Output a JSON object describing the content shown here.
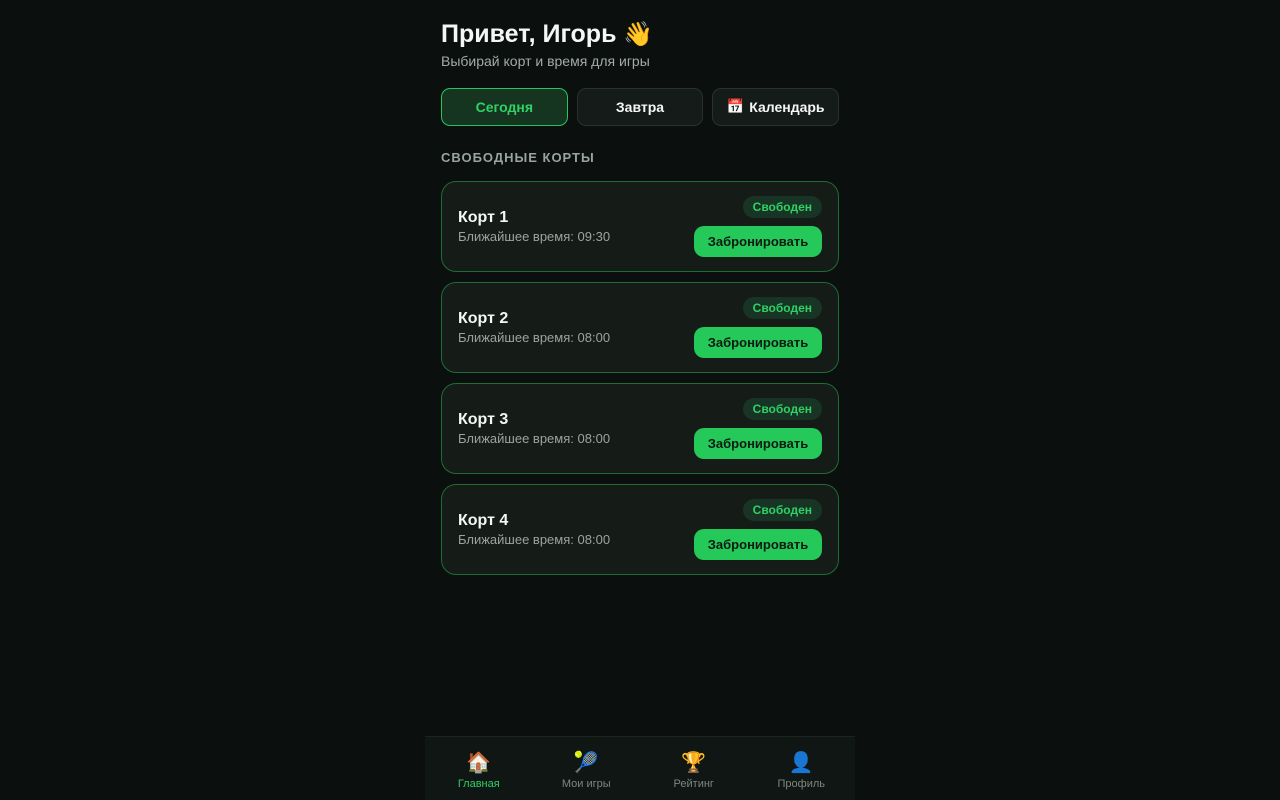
{
  "header": {
    "greeting": "Привет, Игорь",
    "wave_emoji": "👋",
    "subtitle": "Выбирай корт и время для игры"
  },
  "day_tabs": [
    {
      "label": "Сегодня",
      "active": true
    },
    {
      "label": "Завтра",
      "active": false
    },
    {
      "label": "Календарь",
      "icon": "📅",
      "active": false
    }
  ],
  "section_title": "СВОБОДНЫЕ КОРТЫ",
  "courts": [
    {
      "name": "Корт 1",
      "time_prefix": "Ближайшее время:",
      "time": "09:30",
      "status": "Свободен",
      "book_label": "Забронировать"
    },
    {
      "name": "Корт 2",
      "time_prefix": "Ближайшее время:",
      "time": "08:00",
      "status": "Свободен",
      "book_label": "Забронировать"
    },
    {
      "name": "Корт 3",
      "time_prefix": "Ближайшее время:",
      "time": "08:00",
      "status": "Свободен",
      "book_label": "Забронировать"
    },
    {
      "name": "Корт 4",
      "time_prefix": "Ближайшее время:",
      "time": "08:00",
      "status": "Свободен",
      "book_label": "Забронировать"
    }
  ],
  "bottom_nav": [
    {
      "label": "Главная",
      "icon": "🏠",
      "icon_name": "home-icon",
      "active": true
    },
    {
      "label": "Мои игры",
      "icon": "🎾",
      "icon_name": "tennis-icon",
      "active": false
    },
    {
      "label": "Рейтинг",
      "icon": "🏆",
      "icon_name": "trophy-icon",
      "active": false
    },
    {
      "label": "Профиль",
      "icon": "👤",
      "icon_name": "profile-icon",
      "active": false
    }
  ],
  "colors": {
    "background": "#0b0f0d",
    "accent": "#24c95a",
    "card_border": "#1f6b36",
    "muted_text": "#9aa49e"
  }
}
